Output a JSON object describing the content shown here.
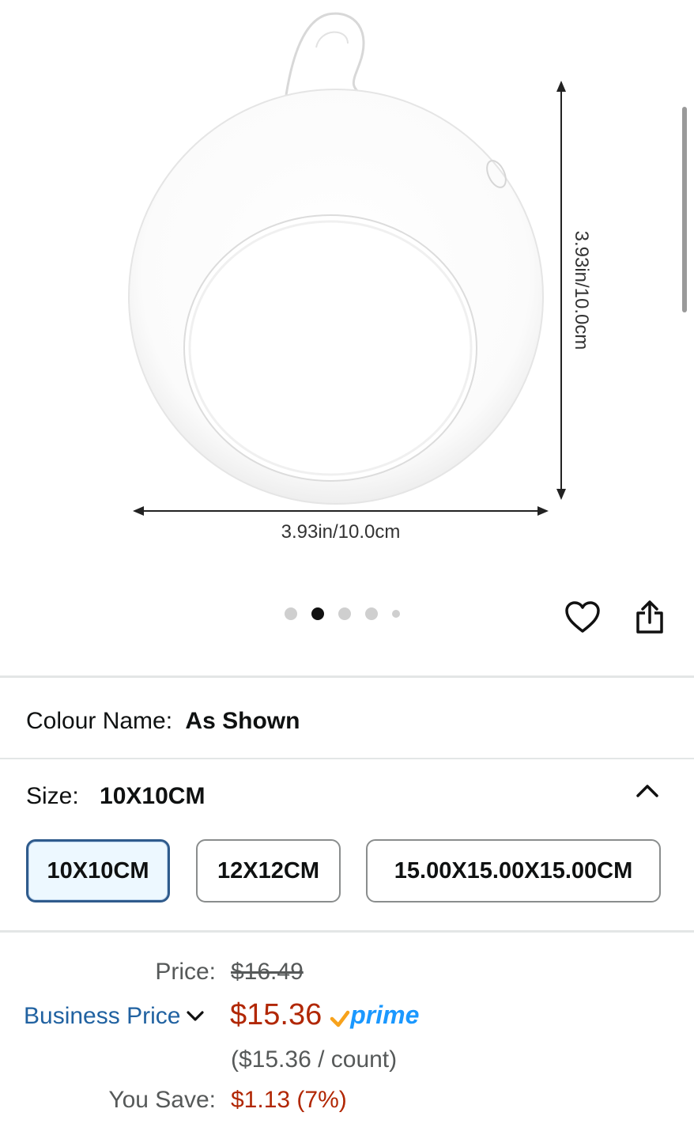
{
  "image": {
    "width_label": "3.93in/10.0cm",
    "height_label": "3.93in/10.0cm",
    "dots": 5,
    "active_dot": 1
  },
  "actions": {
    "wishlist_icon": "heart-icon",
    "share_icon": "share-icon"
  },
  "colour": {
    "label": "Colour Name:",
    "value": "As Shown"
  },
  "size": {
    "label": "Size:",
    "value": "10X10CM",
    "options": [
      "10X10CM",
      "12X12CM",
      "15.00X15.00X15.00CM"
    ],
    "selected": 0
  },
  "pricing": {
    "price_label": "Price:",
    "list_price": "$16.49",
    "business_label": "Business Price",
    "business_price": "$15.36",
    "prime": "prime",
    "unit_price": "($15.36 / count)",
    "save_label": "You Save:",
    "save_value": "$1.13 (7%)"
  },
  "colors": {
    "price_red": "#b12704",
    "link_blue": "#2162a1",
    "prime_blue": "#1a98ff",
    "prime_orange": "#f7a21b"
  }
}
